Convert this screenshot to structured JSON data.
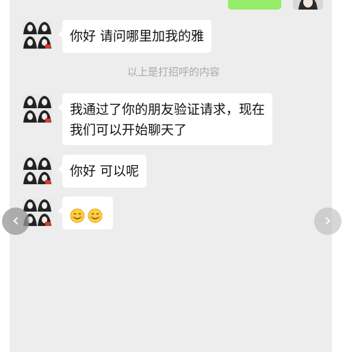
{
  "conversation": {
    "system_note": "以上是打招呼的内容",
    "messages": [
      {
        "lines": [
          "你好 请问哪里加我的雅"
        ]
      },
      {
        "lines": [
          "我通过了你的朋友验证请求，现在",
          "我们可以开始聊天了"
        ]
      },
      {
        "lines": [
          "你好 可以呢"
        ]
      },
      {
        "emoji": [
          "smiling-face",
          "smiling-face"
        ]
      }
    ]
  },
  "navigation": {
    "prev_icon": "chevron-left-icon",
    "next_icon": "chevron-right-icon",
    "prev_glyph": "‹",
    "next_glyph": "›"
  },
  "colors": {
    "background": "#ededed",
    "bubble_incoming": "#ffffff",
    "bubble_outgoing": "#95ec69",
    "system_text": "#a8a8a8"
  }
}
